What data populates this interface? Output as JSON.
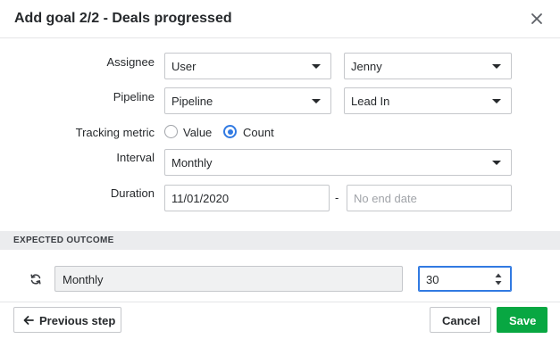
{
  "dialog": {
    "title": "Add goal 2/2 - Deals progressed"
  },
  "form": {
    "assignee": {
      "label": "Assignee",
      "type_value": "User",
      "person_value": "Jenny"
    },
    "pipeline": {
      "label": "Pipeline",
      "pipeline_value": "Pipeline",
      "stage_value": "Lead In"
    },
    "tracking_metric": {
      "label": "Tracking metric",
      "options": [
        "Value",
        "Count"
      ],
      "selected": "Count"
    },
    "interval": {
      "label": "Interval",
      "value": "Monthly"
    },
    "duration": {
      "label": "Duration",
      "start_value": "11/01/2020",
      "separator": "-",
      "end_placeholder": "No end date"
    }
  },
  "expected_outcome": {
    "section_title": "EXPECTED OUTCOME",
    "interval_value": "Monthly",
    "target_value": "30"
  },
  "footer": {
    "prev_label": "Previous step",
    "cancel_label": "Cancel",
    "save_label": "Save"
  },
  "colors": {
    "accent_blue": "#317ae2",
    "save_green": "#08a742",
    "section_bg": "#ebecee"
  },
  "icons": {
    "close": "close-icon",
    "caret": "caret-down-icon",
    "refresh": "refresh-icon",
    "arrow_left": "arrow-left-icon",
    "spinner": "spinner-arrows-icon"
  }
}
